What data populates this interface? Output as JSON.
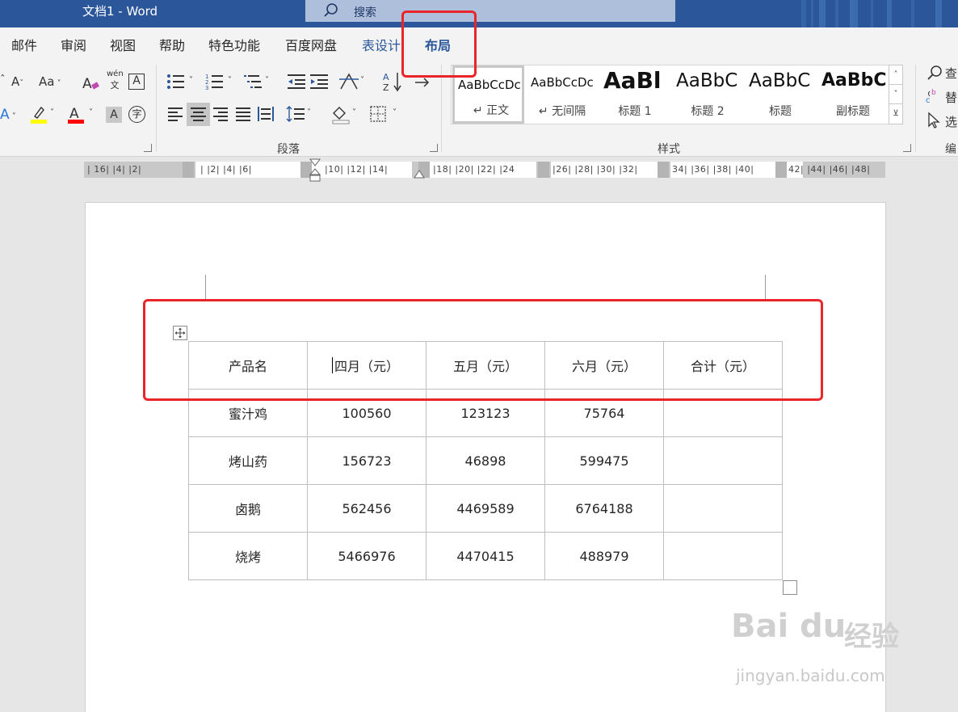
{
  "window": {
    "title": "文档1  -  Word",
    "search_placeholder": "搜索"
  },
  "tabs": [
    "邮件",
    "审阅",
    "视图",
    "帮助",
    "特色功能",
    "百度网盘",
    "表设计",
    "布局"
  ],
  "ribbon": {
    "font_group": {
      "case_label": "Aa",
      "highlight_color": "#ffff00",
      "font_color": "#ff0000",
      "phonetic_top": "wén",
      "phonetic_bottom": "文",
      "border_char": "A",
      "shade_char": "A",
      "enclose_char": "字"
    },
    "paragraph_group": {
      "label": "段落"
    },
    "styles_group": {
      "label": "样式",
      "styles": [
        {
          "sample": "AaBbCcDc",
          "name": "↵ 正文"
        },
        {
          "sample": "AaBbCcDc",
          "name": "↵ 无间隔"
        },
        {
          "sample": "AaBl",
          "name": "标题 1"
        },
        {
          "sample": "AaBbC",
          "name": "标题 2"
        },
        {
          "sample": "AaBbC",
          "name": "标题"
        },
        {
          "sample": "AaBbC",
          "name": "副标题"
        }
      ]
    },
    "editing_group": {
      "find": "查",
      "replace": "替",
      "select": "选",
      "label": "编"
    }
  },
  "ruler": {
    "left_text": "| 16| |4| |2| ",
    "middle_text": "| |2| |4| |6| ",
    "right_text1": "|10| |12| |14| ",
    "right_text2": "|18| |20| |22| |24",
    "right_text3": "|26| |28| |30| |32|",
    "right_text4": "34| |36| |38| |40|",
    "right_text5": "42| |44| |46| |48|"
  },
  "table": {
    "header": [
      "产品名",
      "四月（元）",
      "五月（元）",
      "六月（元）",
      "合计（元）"
    ],
    "rows": [
      [
        "蜜汁鸡",
        "100560",
        "123123",
        "75764",
        ""
      ],
      [
        "烤山药",
        "156723",
        "46898",
        "599475",
        ""
      ],
      [
        "卤鹅",
        "562456",
        "4469589",
        "6764188",
        ""
      ],
      [
        "烧烤",
        "5466976",
        "4470415",
        "488979",
        ""
      ]
    ]
  },
  "watermark": {
    "brand": "Bai du",
    "cn": "经验",
    "url": "jingyan.baidu.com"
  },
  "colors": {
    "titlebar": "#2b579a",
    "highlight": "#e8262a"
  }
}
